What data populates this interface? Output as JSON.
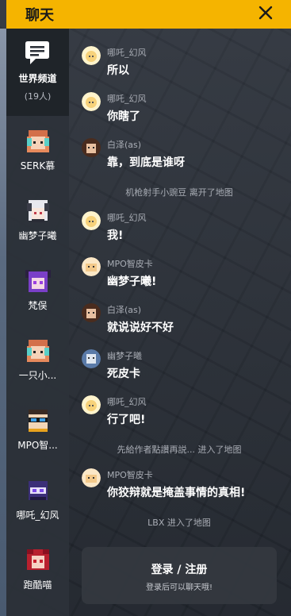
{
  "header": {
    "title": "聊天",
    "close_label": "×"
  },
  "sidebar": {
    "channel": {
      "label": "世界频道",
      "count": "(19人)"
    },
    "friends": [
      {
        "name": "SERK慕"
      },
      {
        "name": "幽梦子曦"
      },
      {
        "name": "梵俣"
      },
      {
        "name": "一只小..."
      },
      {
        "name": "MPO智..."
      },
      {
        "name": "哪吒_幻风"
      },
      {
        "name": "跑酷喵"
      }
    ]
  },
  "messages": [
    {
      "user": "哪吒_幻风",
      "text": "所以"
    },
    {
      "user": "哪吒_幻风",
      "text": "你瞎了"
    },
    {
      "user": "白泽(as)",
      "text": "靠，到底是谁呀"
    },
    {
      "system": "机枪射手小豌豆 离开了地图"
    },
    {
      "user": "哪吒_幻风",
      "text": "我!"
    },
    {
      "user": "MPO智皮卡",
      "text": "幽梦子曦!"
    },
    {
      "user": "白泽(as)",
      "text": "就说说好不好"
    },
    {
      "user": "幽梦子曦",
      "text": "死皮卡"
    },
    {
      "user": "哪吒_幻风",
      "text": "行了吧!"
    },
    {
      "system": "先給作者點讚再説... 进入了地图"
    },
    {
      "user": "MPO智皮卡",
      "text": "你狡辩就是掩盖事情的真相!"
    },
    {
      "system": "LBX 进入了地图"
    }
  ],
  "login": {
    "title": "登录 / 注册",
    "subtitle": "登录后可以聊天哦!"
  },
  "colors": {
    "accent": "#f5b400",
    "panel": "#2d323a",
    "text": "#ffffff",
    "muted": "#a9adb5"
  }
}
